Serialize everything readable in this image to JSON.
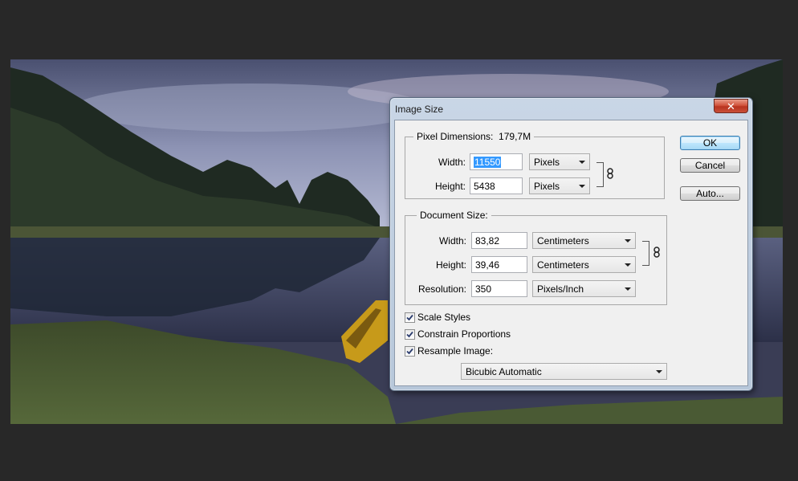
{
  "dialog": {
    "title": "Image Size",
    "close_glyph": "✕",
    "buttons": {
      "ok": "OK",
      "cancel": "Cancel",
      "auto": "Auto..."
    },
    "pixel_dimensions": {
      "legend": "Pixel Dimensions:",
      "size": "179,7M",
      "width_label": "Width:",
      "width_value": "11550",
      "width_unit": "Pixels",
      "height_label": "Height:",
      "height_value": "5438",
      "height_unit": "Pixels"
    },
    "document_size": {
      "legend": "Document Size:",
      "width_label": "Width:",
      "width_value": "83,82",
      "width_unit": "Centimeters",
      "height_label": "Height:",
      "height_value": "39,46",
      "height_unit": "Centimeters",
      "resolution_label": "Resolution:",
      "resolution_value": "350",
      "resolution_unit": "Pixels/Inch"
    },
    "options": {
      "scale_styles": {
        "label": "Scale Styles",
        "checked": true
      },
      "constrain_proportions": {
        "label": "Constrain Proportions",
        "checked": true
      },
      "resample_image": {
        "label": "Resample Image:",
        "checked": true
      }
    },
    "resample_method": "Bicubic Automatic"
  },
  "icons": {
    "link": "chain-link-icon",
    "check": "checkmark-icon",
    "dropdown": "chevron-down-icon",
    "close": "close-icon"
  },
  "colors": {
    "workspace_bg": "#282828",
    "selection": "#3399ff",
    "close_button": "#c9452f"
  }
}
